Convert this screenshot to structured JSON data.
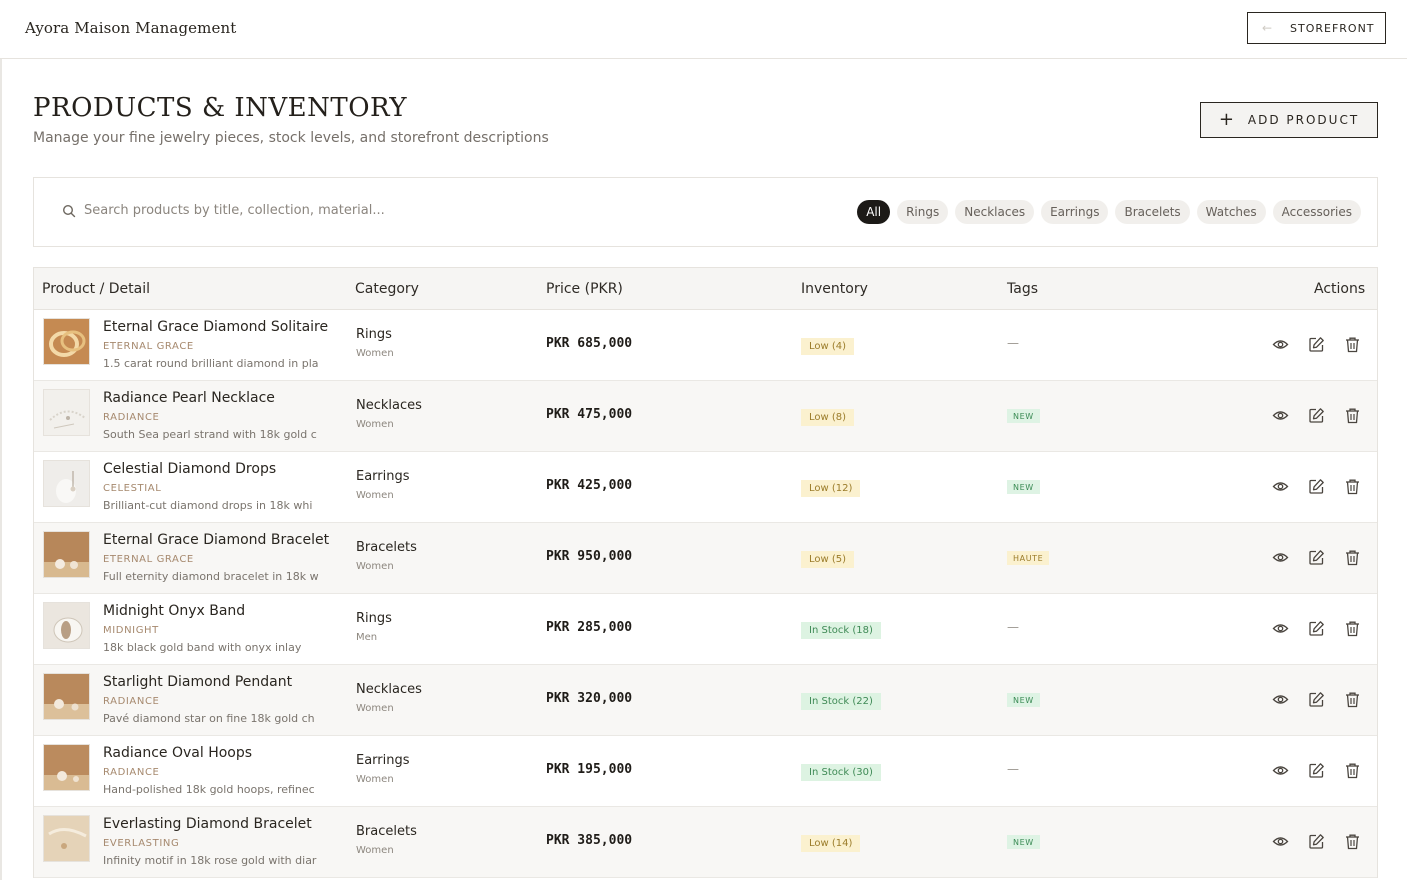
{
  "app": {
    "brand": "Ayora Maison Management",
    "storefront_label": "STOREFRONT"
  },
  "header": {
    "title": "PRODUCTS & INVENTORY",
    "subtitle": "Manage your fine jewelry pieces, stock levels, and storefront descriptions",
    "add_label": "ADD PRODUCT"
  },
  "search": {
    "placeholder": "Search products by title, collection, material..."
  },
  "filters": [
    "All",
    "Rings",
    "Necklaces",
    "Earrings",
    "Bracelets",
    "Watches",
    "Accessories"
  ],
  "active_filter": "All",
  "table": {
    "headers": {
      "product": "Product / Detail",
      "category": "Category",
      "price": "Price (PKR)",
      "inventory": "Inventory",
      "tags": "Tags",
      "actions": "Actions"
    },
    "rows": [
      {
        "name": "Eternal Grace Diamond Solitaire",
        "collection": "ETERNAL GRACE",
        "desc": "1.5 carat round brilliant diamond in pla",
        "category": "Rings",
        "gender": "Women",
        "price": "PKR 685,000",
        "inventory": "Low (4)",
        "stock": "low",
        "tag": "—",
        "thumb": "rings-gold"
      },
      {
        "name": "Radiance Pearl Necklace",
        "collection": "RADIANCE",
        "desc": "South Sea pearl strand with 18k gold c",
        "category": "Necklaces",
        "gender": "Women",
        "price": "PKR 475,000",
        "inventory": "Low (8)",
        "stock": "low",
        "tag": "NEW",
        "thumb": "pearl-white"
      },
      {
        "name": "Celestial Diamond Drops",
        "collection": "CELESTIAL",
        "desc": "Brilliant-cut diamond drops in 18k whi",
        "category": "Earrings",
        "gender": "Women",
        "price": "PKR 425,000",
        "inventory": "Low (12)",
        "stock": "low",
        "tag": "NEW",
        "thumb": "drops-white"
      },
      {
        "name": "Eternal Grace Diamond Bracelet",
        "collection": "ETERNAL GRACE",
        "desc": "Full eternity diamond bracelet in 18k w",
        "category": "Bracelets",
        "gender": "Women",
        "price": "PKR 950,000",
        "inventory": "Low (5)",
        "stock": "low",
        "tag": "HAUTE",
        "thumb": "bracelet-tan"
      },
      {
        "name": "Midnight Onyx Band",
        "collection": "MIDNIGHT",
        "desc": "18k black gold band with onyx inlay",
        "category": "Rings",
        "gender": "Men",
        "price": "PKR 285,000",
        "inventory": "In Stock (18)",
        "stock": "in",
        "tag": "—",
        "thumb": "band-cream"
      },
      {
        "name": "Starlight Diamond Pendant",
        "collection": "RADIANCE",
        "desc": "Pavé diamond star on fine 18k gold ch",
        "category": "Necklaces",
        "gender": "Women",
        "price": "PKR 320,000",
        "inventory": "In Stock (22)",
        "stock": "in",
        "tag": "NEW",
        "thumb": "pendant-tan"
      },
      {
        "name": "Radiance Oval Hoops",
        "collection": "RADIANCE",
        "desc": "Hand-polished 18k gold hoops, refinec",
        "category": "Earrings",
        "gender": "Women",
        "price": "PKR 195,000",
        "inventory": "In Stock (30)",
        "stock": "in",
        "tag": "—",
        "thumb": "hoops-tan"
      },
      {
        "name": "Everlasting Diamond Bracelet",
        "collection": "EVERLASTING",
        "desc": "Infinity motif in 18k rose gold with diar",
        "category": "Bracelets",
        "gender": "Women",
        "price": "PKR 385,000",
        "inventory": "Low (14)",
        "stock": "low",
        "tag": "NEW",
        "thumb": "bracelet-sand"
      }
    ]
  },
  "colors": {
    "accent": "#2a2620",
    "collection": "#a6896e",
    "low_bg": "#fbf1cf",
    "instock_bg": "#ddf3e2"
  },
  "icons": {
    "search": "search-icon",
    "view": "eye-icon",
    "edit": "edit-icon",
    "delete": "trash-icon",
    "back": "arrow-left-icon",
    "add": "plus-icon"
  }
}
